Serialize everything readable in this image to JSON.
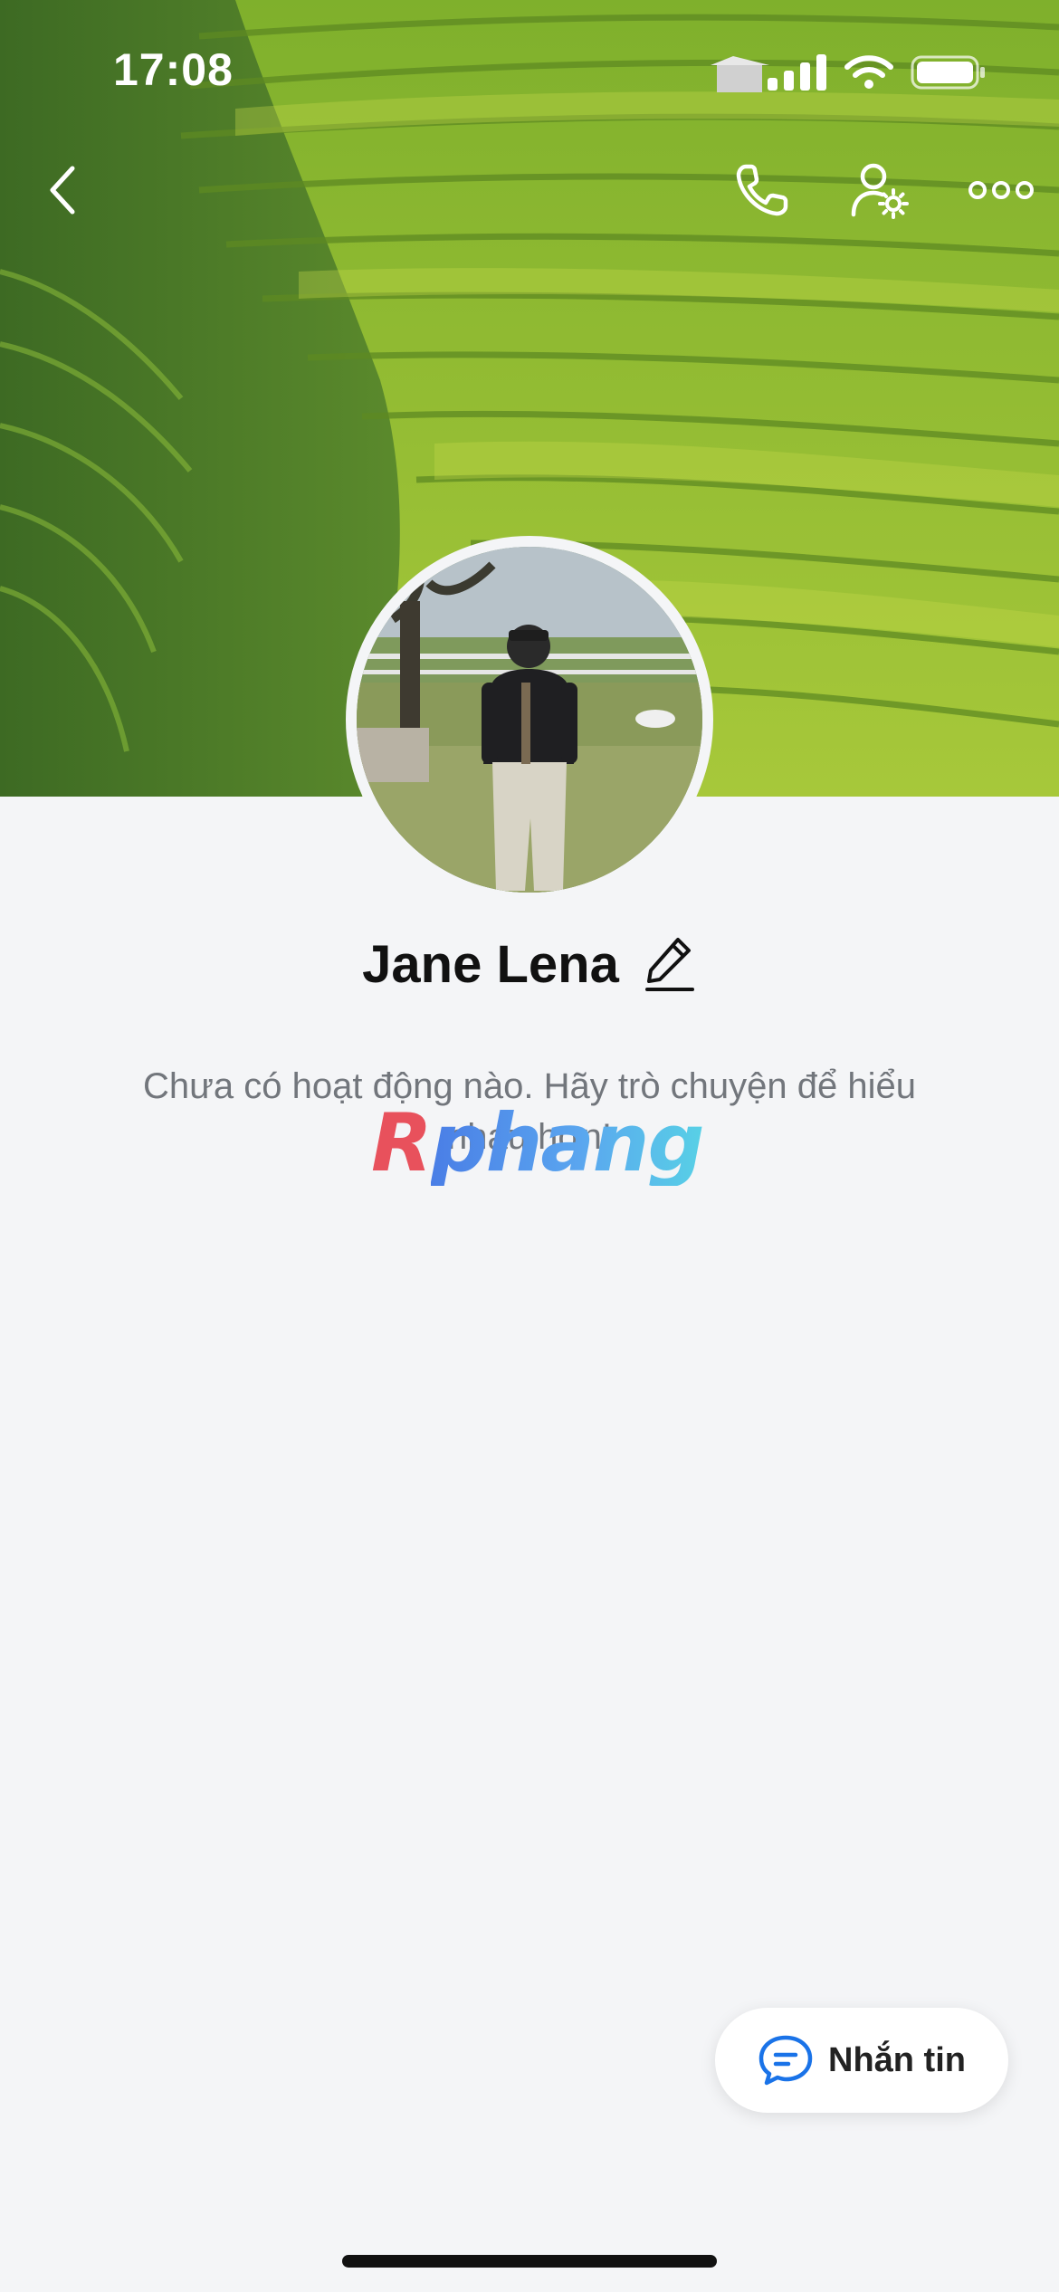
{
  "status_bar": {
    "time": "17:08"
  },
  "header": {
    "back_icon": "chevron-left-icon",
    "call_icon": "phone-icon",
    "settings_icon": "user-settings-icon",
    "more_icon": "more-horizontal-icon"
  },
  "profile": {
    "name": "Jane Lena",
    "edit_icon": "pencil-icon"
  },
  "empty_state": {
    "message": "Chưa có hoạt động nào. Hãy trò chuyện để hiểu nhau hơn!"
  },
  "watermark": {
    "part1": "R",
    "part2": "phang"
  },
  "message_button": {
    "label": "Nhắn tin",
    "icon": "chat-bubble-icon"
  },
  "colors": {
    "background": "#f4f5f7",
    "accent": "#1a73e8",
    "text_primary": "#111111",
    "text_secondary": "#72767c"
  }
}
